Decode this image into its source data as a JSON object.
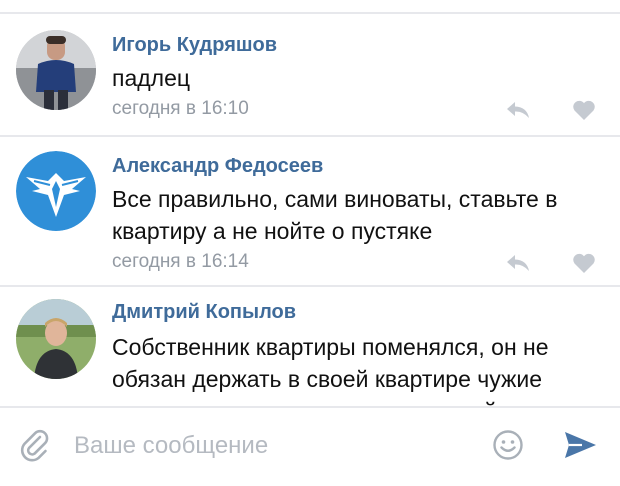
{
  "comments": [
    {
      "author": "Игорь Кудряшов",
      "text": "падлец",
      "time": "сегодня в 16:10",
      "avatar_icon": "user-photo-man-navy-shirt"
    },
    {
      "author": "Александр Федосеев",
      "text": "Все правильно, сами виноваты, ставьте в квартиру а не нойте о пустяке",
      "time": "сегодня в 16:14",
      "avatar_icon": "eagle-logo"
    },
    {
      "author": "Дмитрий Копылов",
      "text": "Собственник квартиры поменялся, он не обязан держать в своей квартире чужие коляски, как это делал предыдущий",
      "time": "",
      "avatar_icon": "user-photo-young-man-field"
    }
  ],
  "composer": {
    "placeholder": "Ваше сообщение",
    "attach_icon": "paperclip-icon",
    "emoji_icon": "smiley-icon",
    "send_icon": "send-arrow-icon"
  },
  "colors": {
    "author": "#3f6b9a",
    "meta": "#939aa3",
    "action_icon": "#c5cad1",
    "send": "#4a76a8",
    "divider": "#e7e8ec"
  }
}
